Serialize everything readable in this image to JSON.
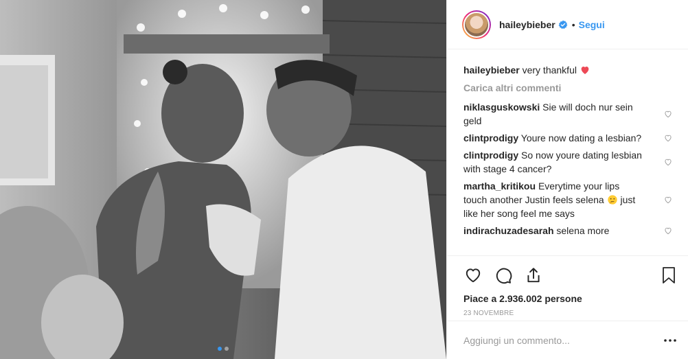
{
  "post": {
    "author": "haileybieber",
    "follow_label": "Segui",
    "separator": "•",
    "caption": {
      "username": "haileybieber",
      "text": "very thankful"
    },
    "load_more_label": "Carica altri commenti",
    "comments": [
      {
        "username": "niklasguskowski",
        "text": "Sie will doch nur sein geld"
      },
      {
        "username": "clintprodigy",
        "text": "Youre now dating a lesbian?"
      },
      {
        "username": "clintprodigy",
        "text": "So now youre dating lesbian with stage 4 cancer?"
      },
      {
        "username": "martha_kritikou",
        "text": "Everytime your lips touch another Justin feels selena",
        "text_after_emoji": "just like her song feel me says"
      },
      {
        "username": "indirachuzadesarah",
        "text": "selena more"
      }
    ],
    "likes_text": "Piace a 2.936.002 persone",
    "date": "23 NOVEMBRE",
    "comment_placeholder": "Aggiungi un commento..."
  },
  "colors": {
    "accent": "#3897f0",
    "heart": "#ed4956",
    "muted": "#999999"
  },
  "icons": {
    "verified": "verified-badge-icon",
    "like": "heart-icon",
    "comment": "comment-icon",
    "share": "share-icon",
    "save": "bookmark-icon",
    "more": "more-options-icon"
  },
  "carousel": {
    "slides": 2,
    "active": 1
  }
}
